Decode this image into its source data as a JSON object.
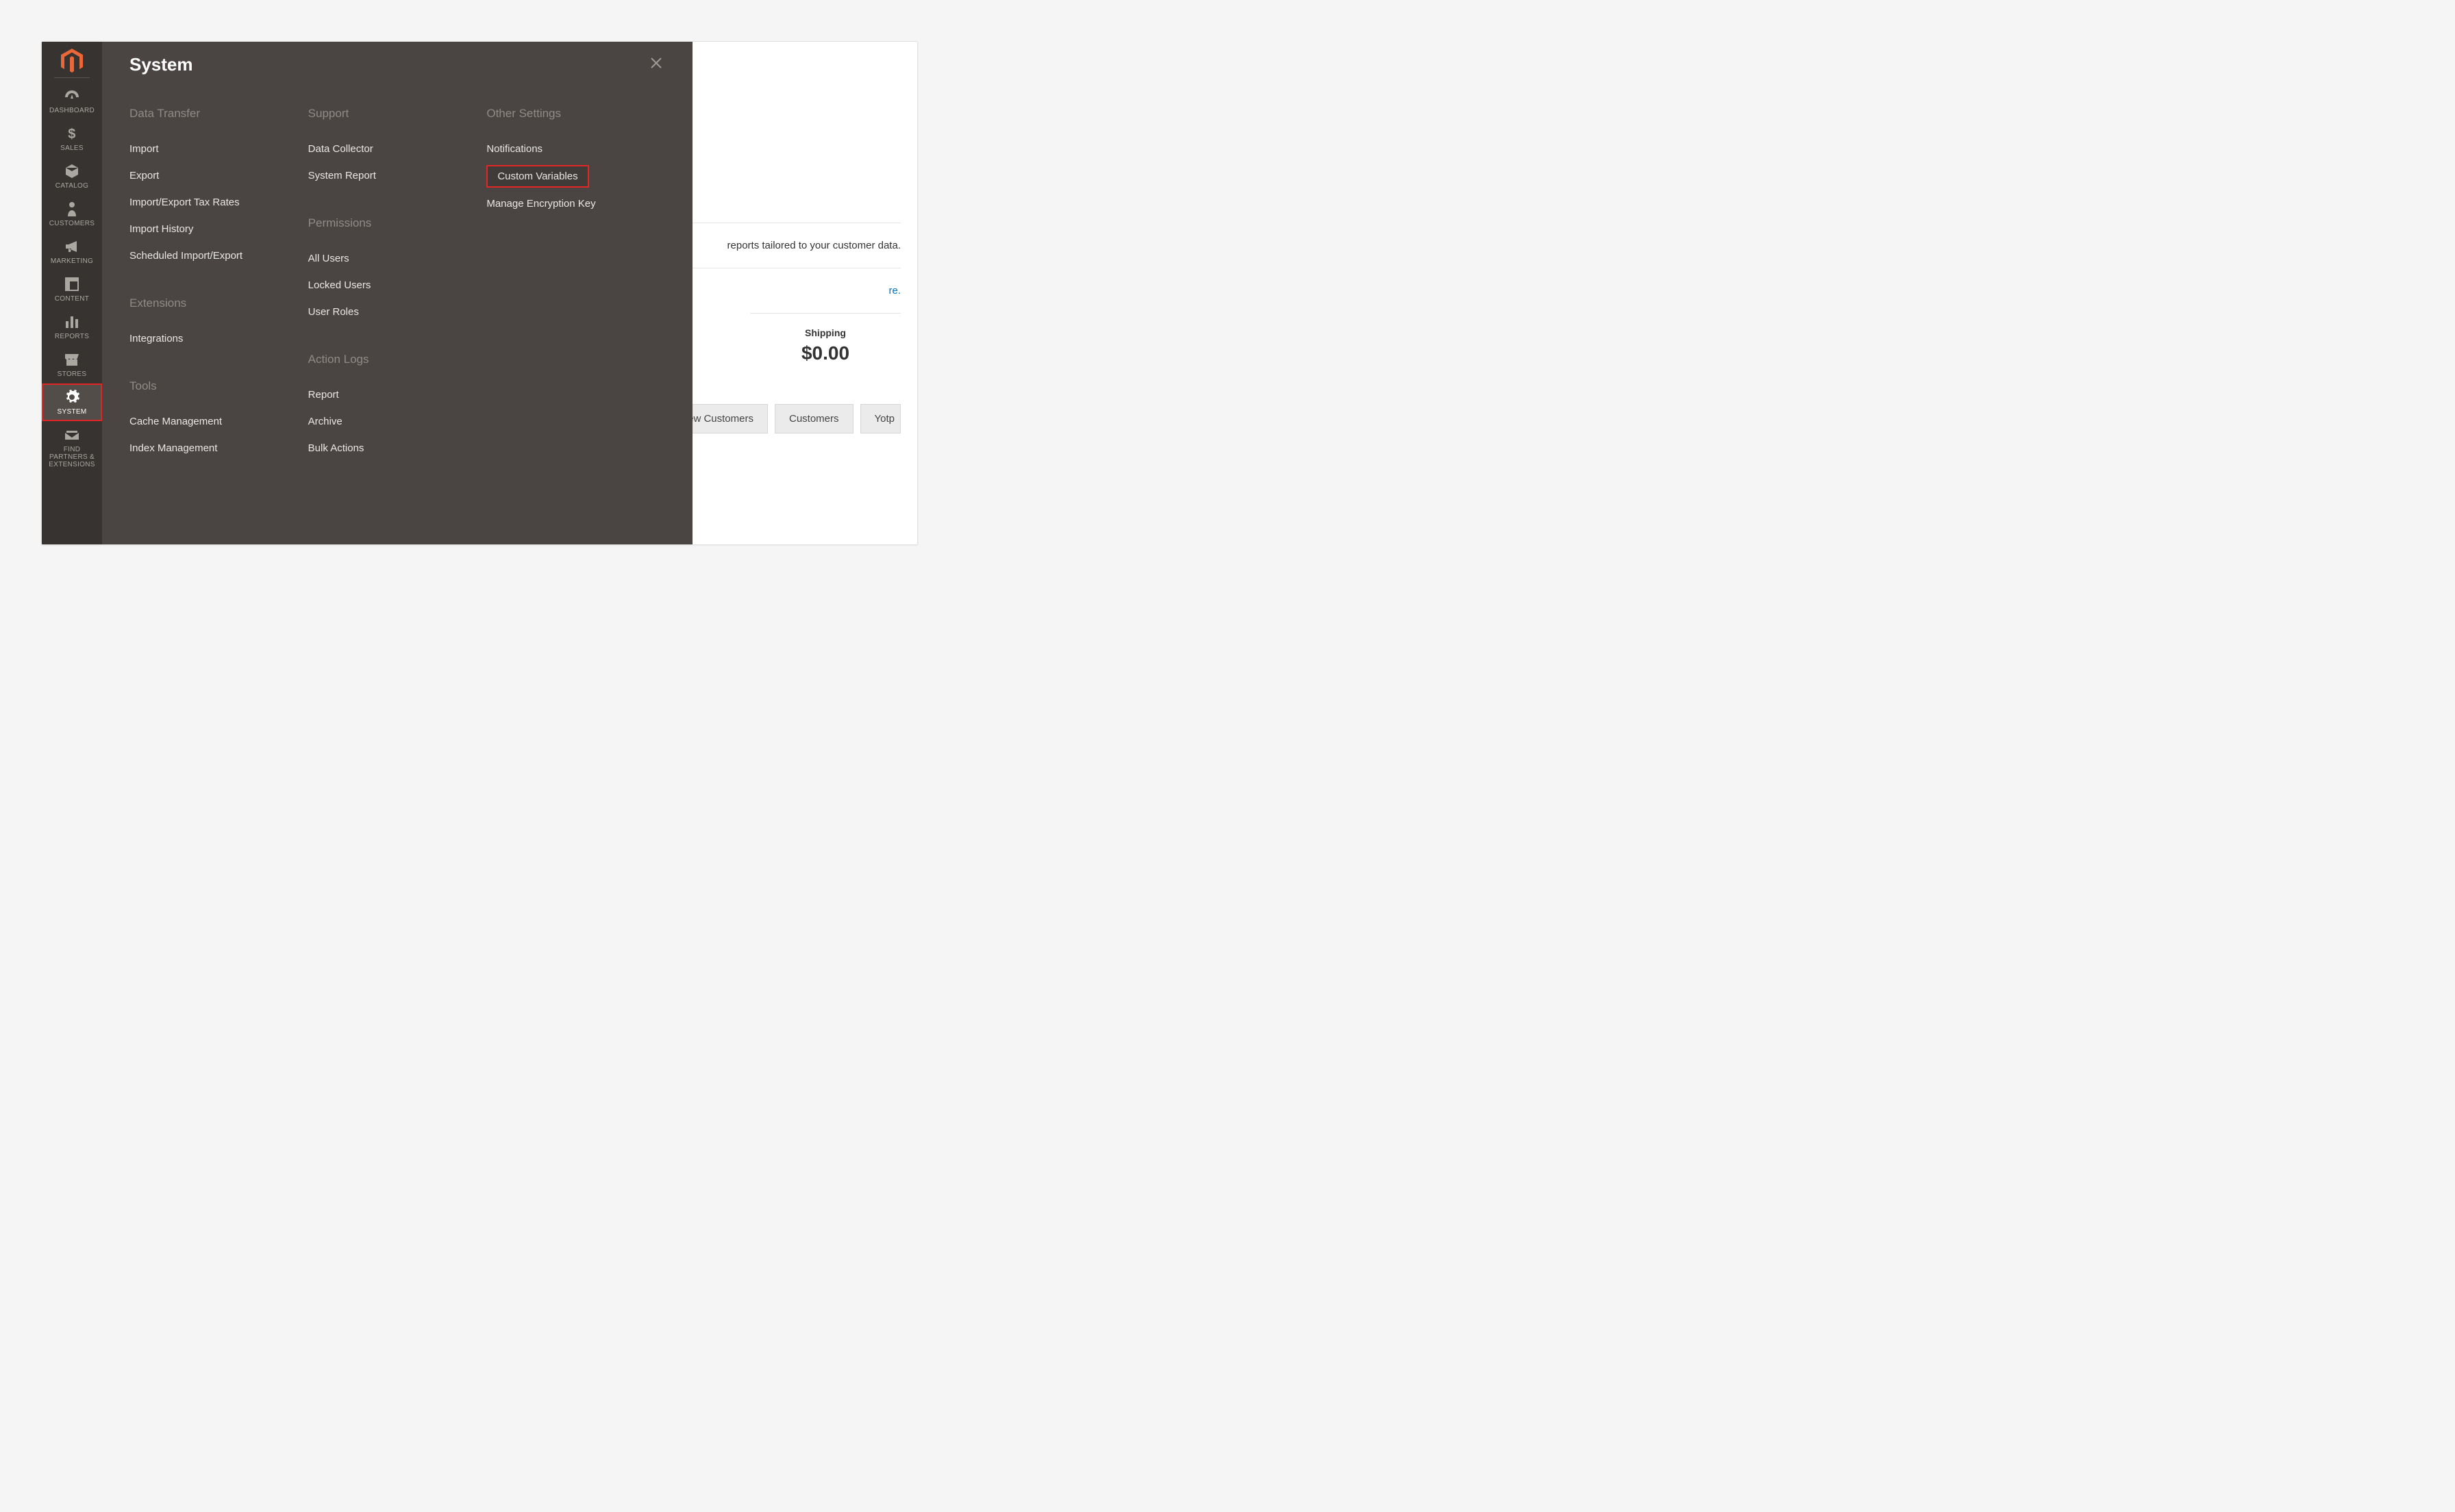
{
  "sidebar": {
    "items": [
      {
        "id": "dashboard",
        "label": "DASHBOARD"
      },
      {
        "id": "sales",
        "label": "SALES"
      },
      {
        "id": "catalog",
        "label": "CATALOG"
      },
      {
        "id": "customers",
        "label": "CUSTOMERS"
      },
      {
        "id": "marketing",
        "label": "MARKETING"
      },
      {
        "id": "content",
        "label": "CONTENT"
      },
      {
        "id": "reports",
        "label": "REPORTS"
      },
      {
        "id": "stores",
        "label": "STORES"
      },
      {
        "id": "system",
        "label": "SYSTEM"
      },
      {
        "id": "find-partners",
        "label": "FIND PARTNERS & EXTENSIONS"
      }
    ],
    "active": "system"
  },
  "flyout": {
    "title": "System",
    "columns": [
      [
        {
          "title": "Data Transfer",
          "items": [
            "Import",
            "Export",
            "Import/Export Tax Rates",
            "Import History",
            "Scheduled Import/Export"
          ]
        },
        {
          "title": "Extensions",
          "items": [
            "Integrations"
          ]
        },
        {
          "title": "Tools",
          "items": [
            "Cache Management",
            "Index Management"
          ]
        }
      ],
      [
        {
          "title": "Support",
          "items": [
            "Data Collector",
            "System Report"
          ]
        },
        {
          "title": "Permissions",
          "items": [
            "All Users",
            "Locked Users",
            "User Roles"
          ]
        },
        {
          "title": "Action Logs",
          "items": [
            "Report",
            "Archive",
            "Bulk Actions"
          ]
        }
      ],
      [
        {
          "title": "Other Settings",
          "items": [
            "Notifications",
            "Custom Variables",
            "Manage Encryption Key"
          ]
        }
      ]
    ],
    "highlighted_item": "Custom Variables"
  },
  "content": {
    "tagline": "reports tailored to your customer data.",
    "link_suffix": "re.",
    "stat": {
      "label": "Shipping",
      "value": "$0.00"
    },
    "tabs": [
      "New Customers",
      "Customers",
      "Yotp"
    ]
  }
}
